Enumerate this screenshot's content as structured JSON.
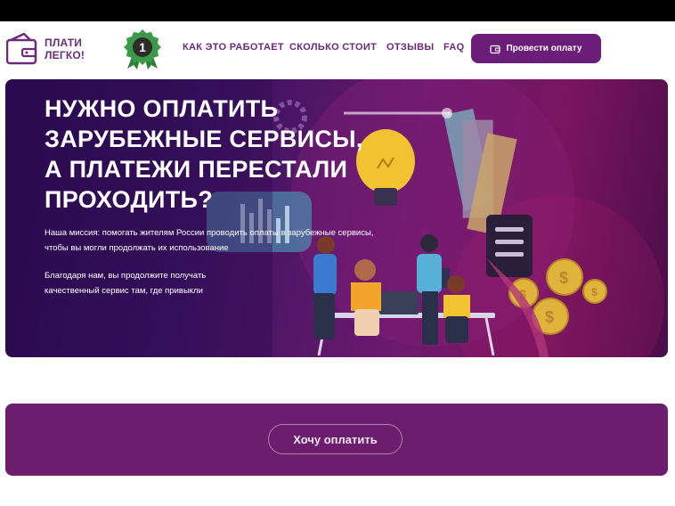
{
  "header": {
    "logo_line1": "ПЛАТИ",
    "logo_line2": "ЛЕГКО!",
    "award_number": "1",
    "nav": [
      {
        "label": "КАК ЭТО РАБОТАЕТ"
      },
      {
        "label": "СКОЛЬКО СТОИТ"
      },
      {
        "label": "ОТЗЫВЫ"
      },
      {
        "label": "FAQ"
      }
    ],
    "pay_button_label": "Провести оплату"
  },
  "hero": {
    "title_lines": [
      "НУЖНО ОПЛАТИТЬ",
      "ЗАРУБЕЖНЫЕ СЕРВИСЫ,",
      "А ПЛАТЕЖИ ПЕРЕСТАЛИ",
      "ПРОХОДИТЬ?"
    ],
    "paragraph1_lines": [
      "Наша миссия: помогать жителям России проводить оплаты в зарубежные сервисы,",
      "чтобы вы могли продолжать их использование"
    ],
    "paragraph2_lines": [
      "Благодаря нам, вы продолжите получать",
      "качественный сервис там, где привыкли"
    ]
  },
  "cta": {
    "button_label": "Хочу оплатить"
  },
  "colors": {
    "brand_purple": "#6c1d7a",
    "cta_panel": "#6d1d6e",
    "gold": "#e0b43a",
    "award_green": "#3a9a4a"
  }
}
